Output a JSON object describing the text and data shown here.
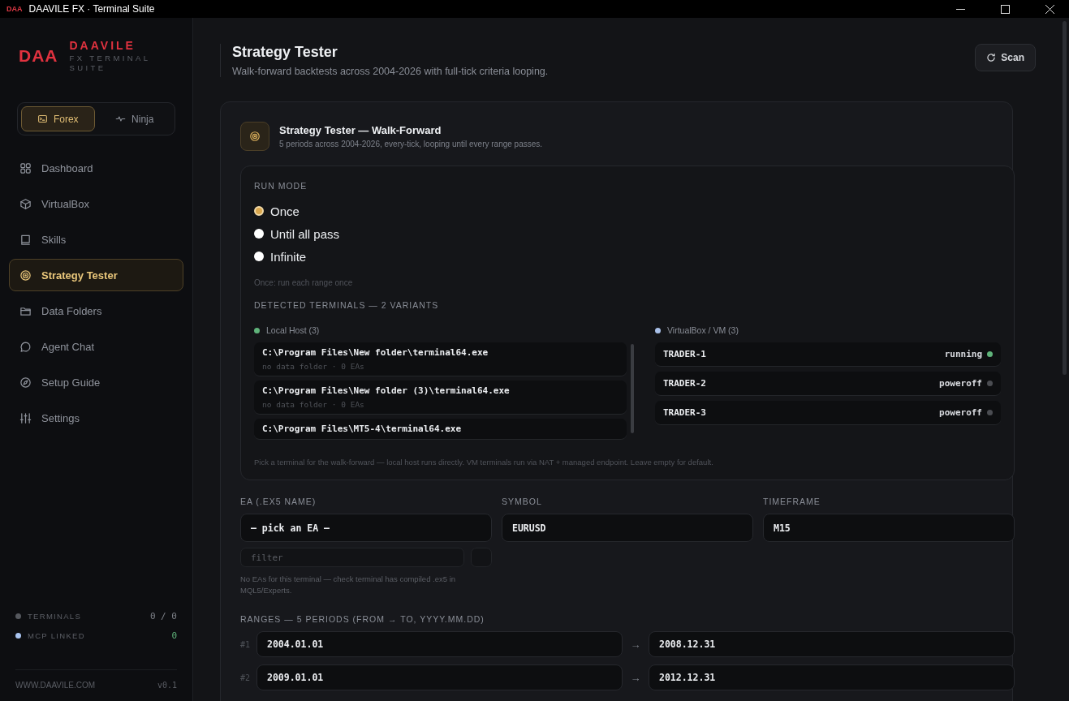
{
  "window": {
    "title": "DAAVILE FX · Terminal Suite",
    "app_mark": "DAA"
  },
  "brand": {
    "mark": "DAA",
    "name": "DAAVILE",
    "tagline": "FX TERMINAL SUITE"
  },
  "mode_switch": [
    {
      "label": "Forex",
      "kind": "terminal",
      "selected": true
    },
    {
      "label": "Ninja",
      "kind": "pulse",
      "selected": false
    }
  ],
  "nav": [
    {
      "label": "Dashboard",
      "kind": "grid",
      "selected": false
    },
    {
      "label": "VirtualBox",
      "kind": "cube",
      "selected": false
    },
    {
      "label": "Skills",
      "kind": "book",
      "selected": false
    },
    {
      "label": "Strategy Tester",
      "kind": "target",
      "selected": true
    },
    {
      "label": "Data Folders",
      "kind": "folder",
      "selected": false
    },
    {
      "label": "Agent Chat",
      "kind": "chat",
      "selected": false
    },
    {
      "label": "Setup Guide",
      "kind": "compass",
      "selected": false
    },
    {
      "label": "Settings",
      "kind": "sliders",
      "selected": false
    }
  ],
  "status": [
    {
      "label": "TERMINALS",
      "value": "0 / 0",
      "color": "#55585e",
      "kind": "muted"
    },
    {
      "label": "MCP LINKED",
      "value": "0",
      "color": "#a9c4f0",
      "kind": "ok"
    }
  ],
  "footer": {
    "site": "WWW.DAAVILE.COM",
    "version": "v0.1"
  },
  "header": {
    "title": "Strategy Tester",
    "subtitle": "Walk-forward backtests across 2004-2026 with full-tick criteria looping.",
    "action": "Scan"
  },
  "card": {
    "title": "Strategy Tester — Walk-Forward",
    "subtitle": "5 periods across 2004-2026, every-tick, looping until every range passes."
  },
  "run_mode": {
    "label": "RUN MODE",
    "options": [
      {
        "label": "Once",
        "selected": true
      },
      {
        "label": "Until all pass",
        "selected": false
      },
      {
        "label": "Infinite",
        "selected": false
      }
    ],
    "hint": "Once: run each range once"
  },
  "terminals": {
    "label": "DETECTED TERMINALS — 2 VARIANTS",
    "local": {
      "name": "Local Host (3)",
      "color": "#5fb37a",
      "items": [
        {
          "path": "C:\\Program Files\\New folder\\terminal64.exe",
          "detail": "no data folder · 0 EAs"
        },
        {
          "path": "C:\\Program Files\\New folder (3)\\terminal64.exe",
          "detail": "no data folder · 0 EAs"
        },
        {
          "path": "C:\\Program Files\\MT5-4\\terminal64.exe"
        }
      ]
    },
    "vm": {
      "name": "VirtualBox / VM (3)",
      "color": "#a9c0e8",
      "items": [
        {
          "name": "TRADER-1",
          "state": "running",
          "color": "#5fb37a"
        },
        {
          "name": "TRADER-2",
          "state": "poweroff",
          "color": "#4a4c51"
        },
        {
          "name": "TRADER-3",
          "state": "poweroff",
          "color": "#4a4c51"
        }
      ]
    },
    "hint": "Pick a terminal for the walk-forward — local host runs directly. VM terminals run via NAT + managed endpoint. Leave empty for default."
  },
  "fields": [
    {
      "label": "EA (.EX5 NAME)",
      "value": "— pick an EA —"
    },
    {
      "label": "SYMBOL",
      "value": "EURUSD"
    },
    {
      "label": "TIMEFRAME",
      "value": "M15"
    }
  ],
  "ea_filter": {
    "placeholder": "filter"
  },
  "ea_hint": "No EAs for this terminal — check terminal has compiled .ex5 in MQL5/Experts.",
  "ranges": {
    "label": "RANGES — 5 PERIODS (FROM → TO, YYYY.MM.DD)",
    "rows": [
      {
        "index": "#1",
        "from": "2004.01.01",
        "arrow": "→",
        "to": "2008.12.31"
      },
      {
        "index": "#2",
        "from": "2009.01.01",
        "arrow": "→",
        "to": "2012.12.31"
      }
    ]
  }
}
